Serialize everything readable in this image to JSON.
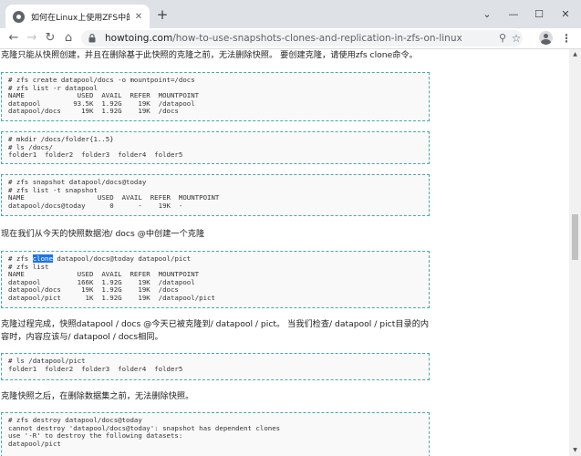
{
  "tab": {
    "title": "如何在Linux上使用ZFS中的快照、克隆和复制",
    "close_glyph": "✕"
  },
  "new_tab_glyph": "+",
  "window_controls": {
    "tab_search_glyph": "⌄",
    "minimize_glyph": "—",
    "maximize_glyph": "☐",
    "close_glyph": "✕"
  },
  "toolbar": {
    "back_glyph": "←",
    "forward_glyph": "→",
    "reload_glyph": "↻",
    "home_glyph": "⌂",
    "url_host": "howtoing.com",
    "url_path": "/how-to-use-snapshots-clones-and-replication-in-zfs-on-linux",
    "search_glyph": "⚲",
    "bookmark_glyph": "☆",
    "menu_glyph": "⋮"
  },
  "article": {
    "intro": "克隆只能从快照创建，并且在删除基于此快照的克隆之前，无法删除快照。 要创建克隆，请使用zfs clone命令。",
    "code1": "# zfs create datapool/docs -o mountpoint=/docs\n# zfs list -r datapool\nNAME             USED  AVAIL  REFER  MOUNTPOINT\ndatapool        93.5K  1.92G    19K  /datapool\ndatapool/docs     19K  1.92G    19K  /docs",
    "code2": "# mkdir /docs/folder{1..5}\n# ls /docs/\nfolder1  folder2  folder3  folder4  folder5",
    "code3": "# zfs snapshot datapool/docs@today\n# zfs list -t snapshot\nNAME                  USED  AVAIL  REFER  MOUNTPOINT\ndatapool/docs@today      0      -    19K  -",
    "para2": "现在我们从今天的快照数据池/ docs @中创建一个克隆",
    "code4_prefix": "# zfs ",
    "code4_highlight": "clone",
    "code4_rest": " datapool/docs@today datapool/pict\n# zfs list\nNAME             USED  AVAIL  REFER  MOUNTPOINT\ndatapool         166K  1.92G    19K  /datapool\ndatapool/docs     19K  1.92G    19K  /docs\ndatapool/pict      1K  1.92G    19K  /datapool/pict",
    "para3": "克隆过程完成，快照datapool / docs @今天已被克隆到/ datapool / pict。 当我们检查/ datapool / pict目录的内容时，内容应该与/ datapool / docs相同。",
    "code5": "# ls /datapool/pict\nfolder1  folder2  folder3  folder4  folder5",
    "para4": "克隆快照之后，在删除数据集之前，无法删除快照。",
    "code6": "# zfs destroy datapool/docs@today\ncannot destroy 'datapool/docs@today': snapshot has dependent clones\nuse '-R' to destroy the following datasets:\ndatapool/pict"
  },
  "scrollbar": {
    "up_glyph": "▲",
    "down_glyph": "▼"
  },
  "colors": {
    "tab_strip": "#dee1e6",
    "code_border": "#4aa7a8",
    "code_bg": "#f9f9f9",
    "selection": "#1a73e8"
  }
}
